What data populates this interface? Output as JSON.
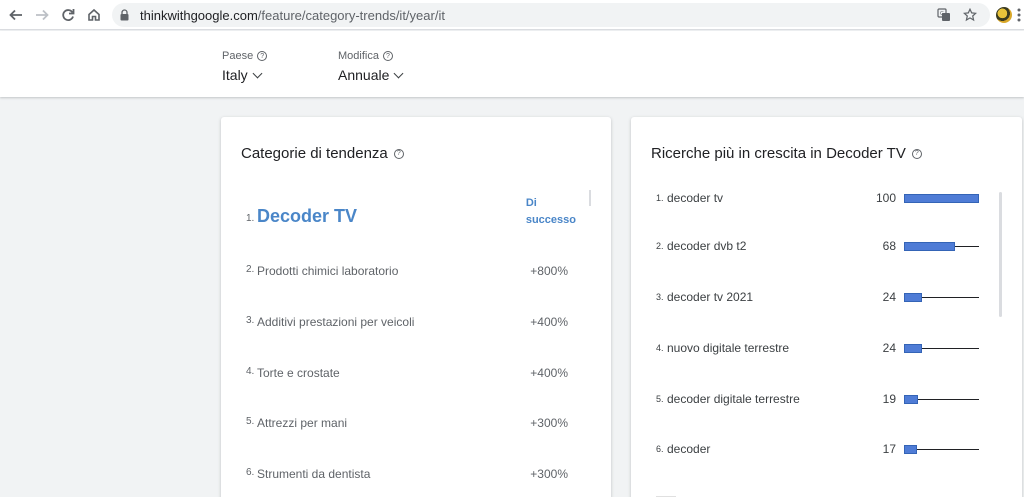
{
  "browser": {
    "url_host": "thinkwithgoogle.com",
    "url_path": "/feature/category-trends/it/year/it"
  },
  "filters": {
    "country": {
      "label": "Paese",
      "value": "Italy"
    },
    "mode": {
      "label": "Modifica",
      "value": "Annuale"
    }
  },
  "trending_categories": {
    "title": "Categorie di tendenza",
    "items": [
      {
        "rank": "1.",
        "name": "Decoder TV",
        "value": "Di\nsuccesso"
      },
      {
        "rank": "2.",
        "name": "Prodotti chimici laboratorio",
        "value": "+800%"
      },
      {
        "rank": "3.",
        "name": "Additivi prestazioni per veicoli",
        "value": "+400%"
      },
      {
        "rank": "4.",
        "name": "Torte e crostate",
        "value": "+400%"
      },
      {
        "rank": "5.",
        "name": "Attrezzi per mani",
        "value": "+300%"
      },
      {
        "rank": "6.",
        "name": "Strumenti da dentista",
        "value": "+300%"
      }
    ]
  },
  "rising_searches": {
    "title": "Ricerche più in crescita in Decoder TV",
    "max": 100,
    "bar_color": "#4f7cd6",
    "items": [
      {
        "rank": "1.",
        "query": "decoder tv",
        "value": 100
      },
      {
        "rank": "2.",
        "query": "decoder dvb t2",
        "value": 68
      },
      {
        "rank": "3.",
        "query": "decoder tv 2021",
        "value": 24
      },
      {
        "rank": "4.",
        "query": "nuovo digitale terrestre",
        "value": 24
      },
      {
        "rank": "5.",
        "query": "decoder digitale terrestre",
        "value": 19
      },
      {
        "rank": "6.",
        "query": "decoder",
        "value": 17
      }
    ]
  }
}
